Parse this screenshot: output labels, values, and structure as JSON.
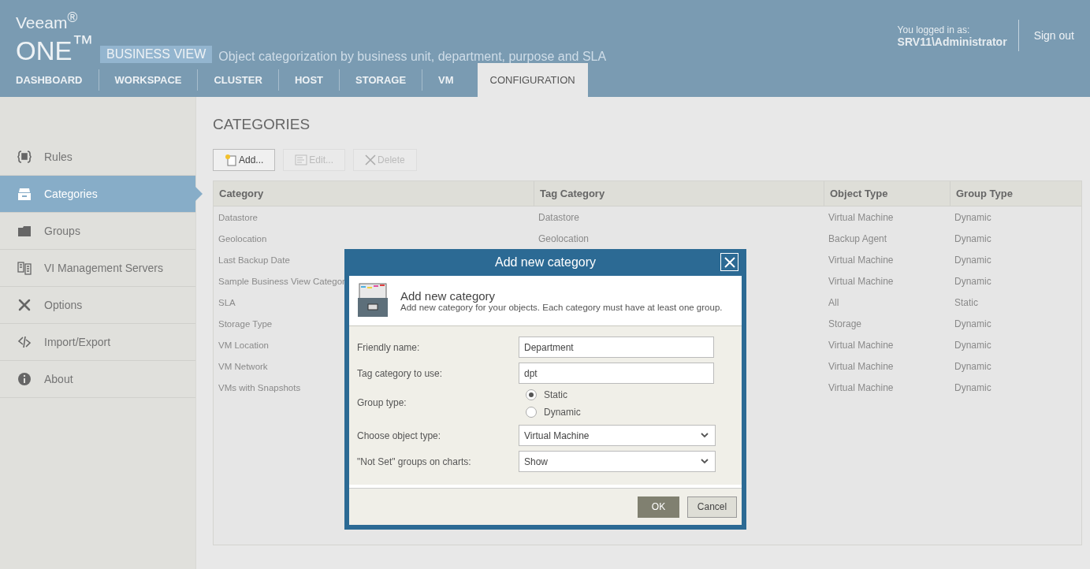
{
  "header": {
    "logo": {
      "brand": "Veeam$^{®}$",
      "product": "ONE$^{™}$",
      "edition": "BUSINESS VIEW"
    },
    "tagline": "Object categorization by business unit, department, purpose and SLA",
    "user": {
      "label": "You logged in as:",
      "name": "SRV11\\Administrator"
    },
    "sign_out": "Sign out"
  },
  "tabs": [
    {
      "label": "DASHBOARD",
      "selected": false
    },
    {
      "label": "WORKSPACE",
      "selected": false
    },
    {
      "label": "CLUSTER",
      "selected": false
    },
    {
      "label": "HOST",
      "selected": false
    },
    {
      "label": "STORAGE",
      "selected": false
    },
    {
      "label": "VM",
      "selected": false
    },
    {
      "label": "CONFIGURATION",
      "selected": true
    }
  ],
  "sidebar": {
    "items": [
      {
        "label": "Rules",
        "selected": false
      },
      {
        "label": "Categories",
        "selected": true
      },
      {
        "label": "Groups",
        "selected": false
      },
      {
        "label": "VI Management Servers",
        "selected": false
      },
      {
        "label": "Options",
        "selected": false
      },
      {
        "label": "Import/Export",
        "selected": false
      },
      {
        "label": "About",
        "selected": false
      }
    ]
  },
  "page_title": "CATEGORIES",
  "toolbar": {
    "buttons": [
      {
        "label": "Add...",
        "disabled": false
      },
      {
        "label": "Edit...",
        "disabled": true
      },
      {
        "label": "Delete",
        "disabled": true
      }
    ]
  },
  "table": {
    "columns": [
      "Category",
      "Tag Category",
      "Object Type",
      "Group Type"
    ],
    "rows": [
      {
        "category": "Datastore",
        "tag_category": "Datastore",
        "object_type": "Virtual Machine",
        "group_type": "Dynamic"
      },
      {
        "category": "Geolocation",
        "tag_category": "Geolocation",
        "object_type": "Backup Agent",
        "group_type": "Dynamic"
      },
      {
        "category": "Last Backup Date",
        "object_type": "Virtual Machine",
        "group_type": "Dynamic"
      },
      {
        "category": "Sample Business View Categor",
        "object_type": "Virtual Machine",
        "group_type": "Dynamic"
      },
      {
        "category": "SLA",
        "object_type": "All",
        "group_type": "Static"
      },
      {
        "category": "Storage Type",
        "object_type": "Storage",
        "group_type": "Dynamic"
      },
      {
        "category": "VM Location",
        "object_type": "Virtual Machine",
        "group_type": "Dynamic"
      },
      {
        "category": "VM Network",
        "object_type": "Virtual Machine",
        "group_type": "Dynamic"
      },
      {
        "category": "VMs with Snapshots",
        "object_type": "Virtual Machine",
        "group_type": "Dynamic"
      }
    ]
  },
  "dialog": {
    "title": "Add new category",
    "heading": "Add new category",
    "description": "Add new category for your objects. Each category must have at least one group.",
    "fields": [
      {
        "kind": "text",
        "label": "Friendly name:",
        "value": "Department"
      },
      {
        "kind": "text",
        "label": "Tag category to use:",
        "value": "dpt"
      },
      {
        "kind": "radio",
        "label": "Group type:",
        "options": [
          {
            "label": "Static",
            "selected": true
          },
          {
            "label": "Dynamic",
            "selected": false
          }
        ]
      },
      {
        "kind": "select",
        "label": "Choose object type:",
        "value": "Virtual Machine"
      },
      {
        "kind": "select",
        "label": "\"Not Set\" groups on charts:",
        "value": "Show"
      }
    ],
    "buttons": [
      {
        "label": "OK",
        "default": true
      },
      {
        "label": "Cancel",
        "default": false
      }
    ]
  }
}
